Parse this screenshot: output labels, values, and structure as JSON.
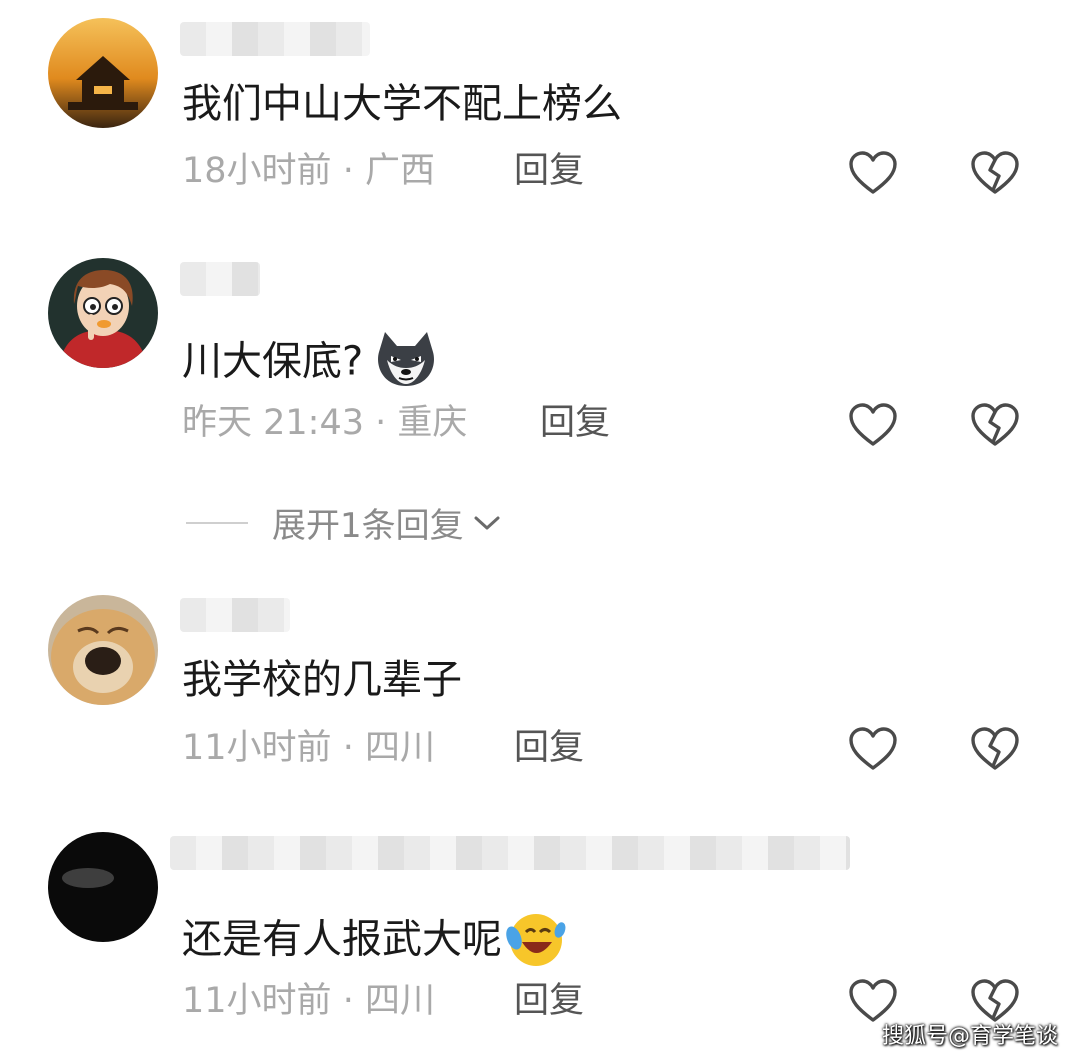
{
  "comments": [
    {
      "text": "我们中山大学不配上榜么",
      "time": "18小时前",
      "location": "广西",
      "reply_label": "回复"
    },
    {
      "text": "川大保底?",
      "time": "昨天 21:43",
      "location": "重庆",
      "reply_label": "回复",
      "emoji": "husky-emoji"
    },
    {
      "text": "我学校的几辈子",
      "time": "11小时前",
      "location": "四川",
      "reply_label": "回复"
    },
    {
      "text": "还是有人报武大呢",
      "time": "11小时前",
      "location": "四川",
      "reply_label": "回复",
      "emoji": "laughing-crying-emoji"
    }
  ],
  "separator": "·",
  "expand_replies": {
    "label": "展开1条回复",
    "icon": "chevron-down-icon"
  },
  "watermark": "搜狐号@育学笔谈",
  "icons": {
    "like": "heart-icon",
    "dislike": "broken-heart-icon"
  },
  "colors": {
    "text": "#1a1a1a",
    "meta": "#a9a9a9",
    "reply": "#555555",
    "icon": "#4a4a4a"
  }
}
